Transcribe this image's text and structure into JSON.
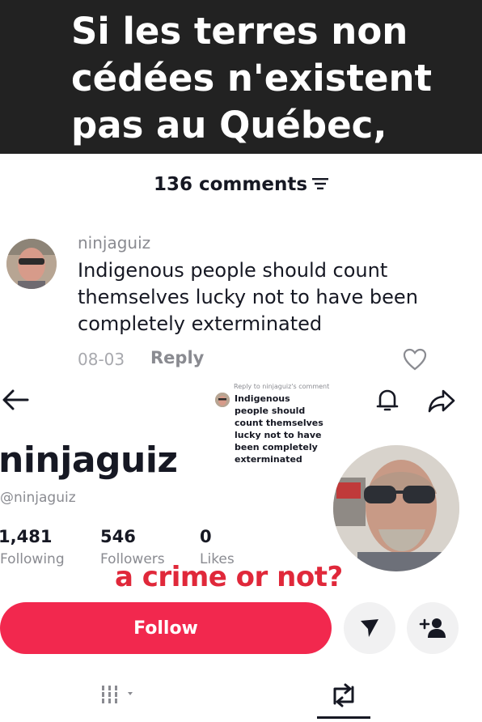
{
  "caption": {
    "lines": [
      "Si les terres non",
      "cédées n'existent",
      "pas au Québec,"
    ]
  },
  "comments": {
    "count_label": "136 comments",
    "sort_icon": "sort-lines-icon",
    "comment": {
      "username": "ninjaguiz",
      "text": "Indigenous people should count themselves lucky not to have been completely exterminated",
      "date": "08-03",
      "reply_label": "Reply",
      "like_icon": "heart-outline-icon"
    }
  },
  "profile": {
    "reply_context": "Reply to ninjaguiz's comment",
    "reply_quote": "Indigenous people should count themselves lucky not to have been completely exterminated",
    "display_name": "ninjaguiz",
    "handle": "@ninjaguiz",
    "stats": [
      {
        "value": "1,481",
        "label": "Following"
      },
      {
        "value": "546",
        "label": "Followers"
      },
      {
        "value": "0",
        "label": "Likes"
      }
    ],
    "overlay_text": "a crime or not?",
    "follow_label": "Follow",
    "colors": {
      "follow": "#f2284e",
      "overlay": "#e0283a",
      "caption_bg": "#222222"
    }
  }
}
